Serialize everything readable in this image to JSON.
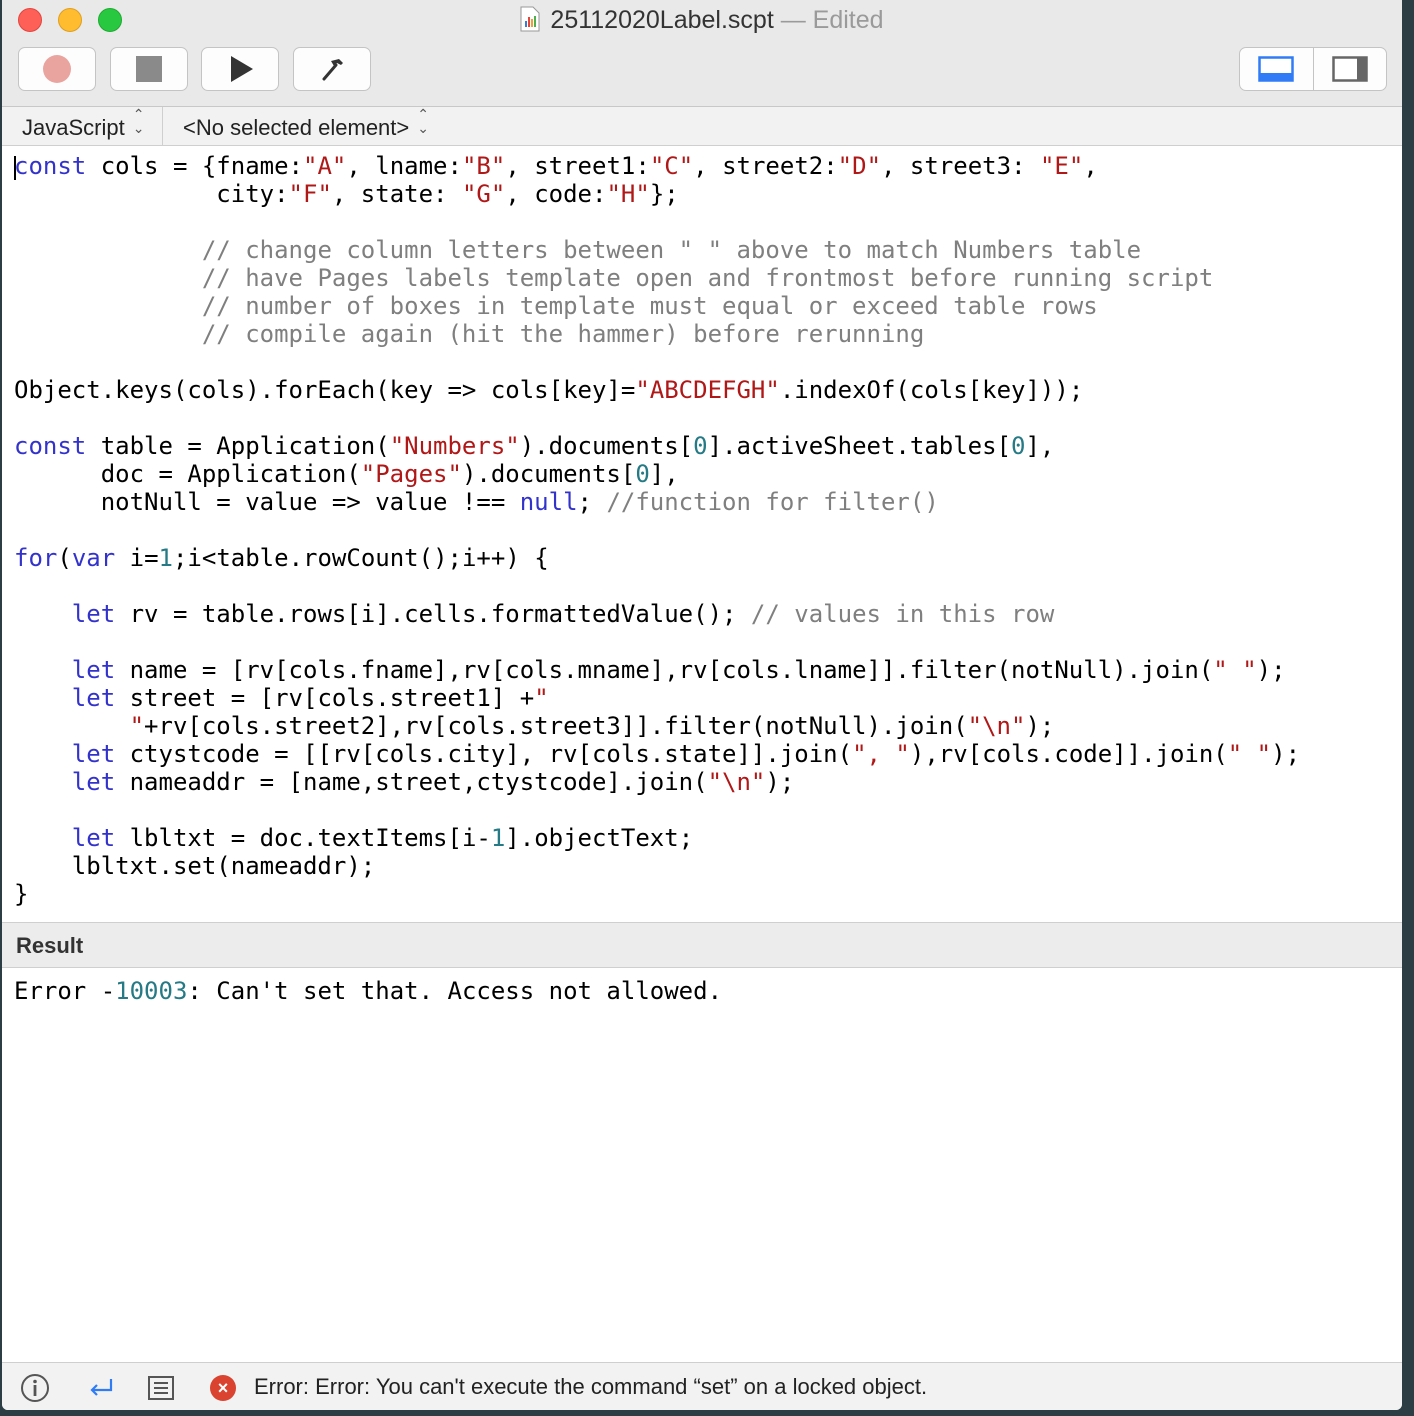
{
  "window": {
    "title": "25112020Label.scpt",
    "edited_label": "— Edited"
  },
  "toolbar": {
    "record": "record-icon",
    "stop": "stop-icon",
    "run": "play-icon",
    "compile": "hammer-icon",
    "view_segments": [
      "bottom-pane-icon",
      "side-pane-icon"
    ]
  },
  "navigation": {
    "language": "JavaScript",
    "element": "<No selected element>"
  },
  "editor": {
    "code": "const cols = {fname:\"A\", lname:\"B\", street1:\"C\", street2:\"D\", street3: \"E\",\n              city:\"F\", state: \"G\", code:\"H\"};\n\n             // change column letters between \" \" above to match Numbers table\n             // have Pages labels template open and frontmost before running script\n             // number of boxes in template must equal or exceed table rows\n             // compile again (hit the hammer) before rerunning\n\nObject.keys(cols).forEach(key => cols[key]=\"ABCDEFGH\".indexOf(cols[key]));\n\nconst table = Application(\"Numbers\").documents[0].activeSheet.tables[0],\n      doc = Application(\"Pages\").documents[0],\n      notNull = value => value !== null; //function for filter()\n\nfor(var i=1;i<table.rowCount();i++) {\n\n    let rv = table.rows[i].cells.formattedValue(); // values in this row\n\n    let name = [rv[cols.fname],rv[cols.mname],rv[cols.lname]].filter(notNull).join(\" \");\n    let street = [rv[cols.street1] +\"\n        \"+rv[cols.street2],rv[cols.street3]].filter(notNull).join(\"\\n\");\n    let ctystcode = [[rv[cols.city], rv[cols.state]].join(\", \"),rv[cols.code]].join(\" \");\n    let nameaddr = [name,street,ctystcode].join(\"\\n\");\n\n    let lbltxt = doc.textItems[i-1].objectText;\n    lbltxt.set(nameaddr);\n}"
  },
  "result": {
    "header": "Result",
    "text": "Error -10003: Can't set that. Access not allowed."
  },
  "statusbar": {
    "icons": [
      "info-icon",
      "return-icon",
      "list-icon"
    ],
    "message": "Error: Error: You can't execute the command “set” on a locked object."
  },
  "colors": {
    "keyword": "#3333cc",
    "string": "#b01818",
    "number": "#257a85",
    "comment": "#7f7f7f",
    "error_icon": "#d9432f"
  }
}
